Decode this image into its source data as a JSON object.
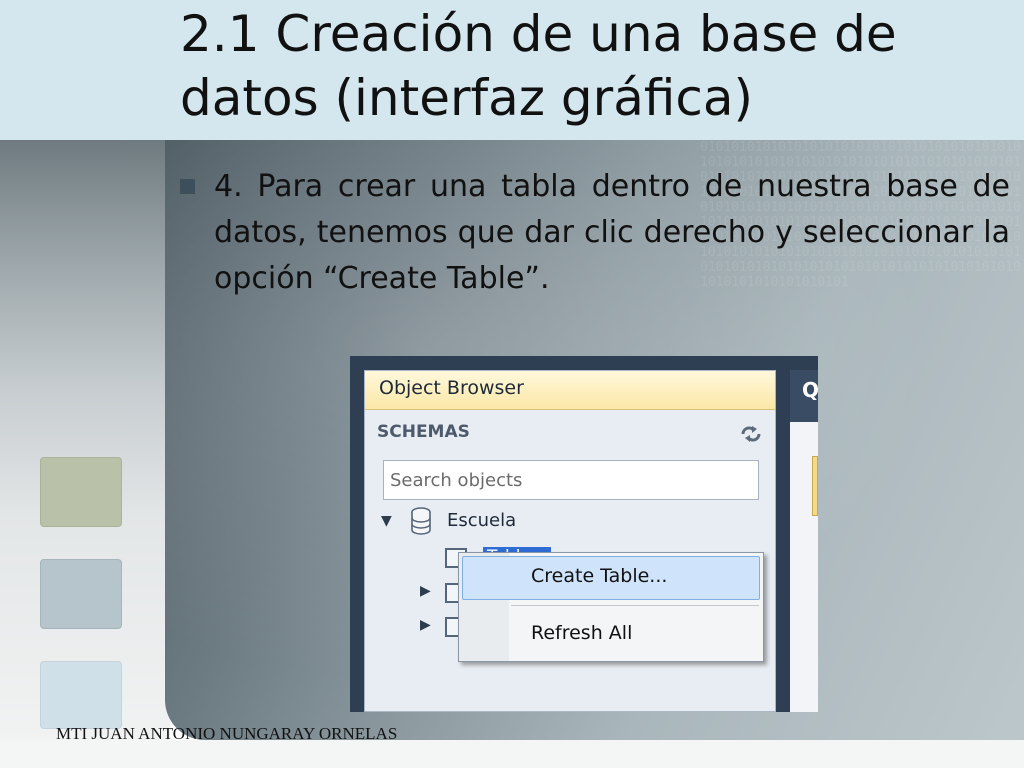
{
  "slide": {
    "title": "2.1 Creación de una base de datos (interfaz gráfica)",
    "bullet": "4.  Para crear una tabla dentro de nuestra base de datos, tenemos que dar clic derecho y seleccionar la opción “Create Table”.",
    "footer": "MTI JUAN ANTONIO NUNGARAY ORNELAS",
    "binary_texture": "0101010101010101010101010101010101010101010101010101010101010101010101010101010101010101010101010101010101010101010101010101010101010101010101010101010101010101010101010101010101010101010101010101010101010101010101010101010101010101010101010101010101010101010101010101010101010101010101010101010101010101010101010101010101010101010101010101010101010101010101010101010101010101010101010101"
  },
  "object_browser": {
    "title": "Object Browser",
    "section": "SCHEMAS",
    "search_placeholder": "Search objects",
    "schema": "Escuela",
    "selected_node": "Tables",
    "right_tab_letter": "Q"
  },
  "context_menu": {
    "items": [
      "Create Table...",
      "Refresh All"
    ]
  },
  "icons": {
    "refresh": "refresh-icon",
    "database": "database-icon",
    "table": "table-icon",
    "expand": "triangle-right-icon",
    "collapse": "triangle-down-icon"
  },
  "colors": {
    "title_band": "#d5e7ee",
    "selection": "#2f6cd4",
    "menu_hover": "#cfe4fb",
    "header_gold": "#fbe8a6"
  }
}
